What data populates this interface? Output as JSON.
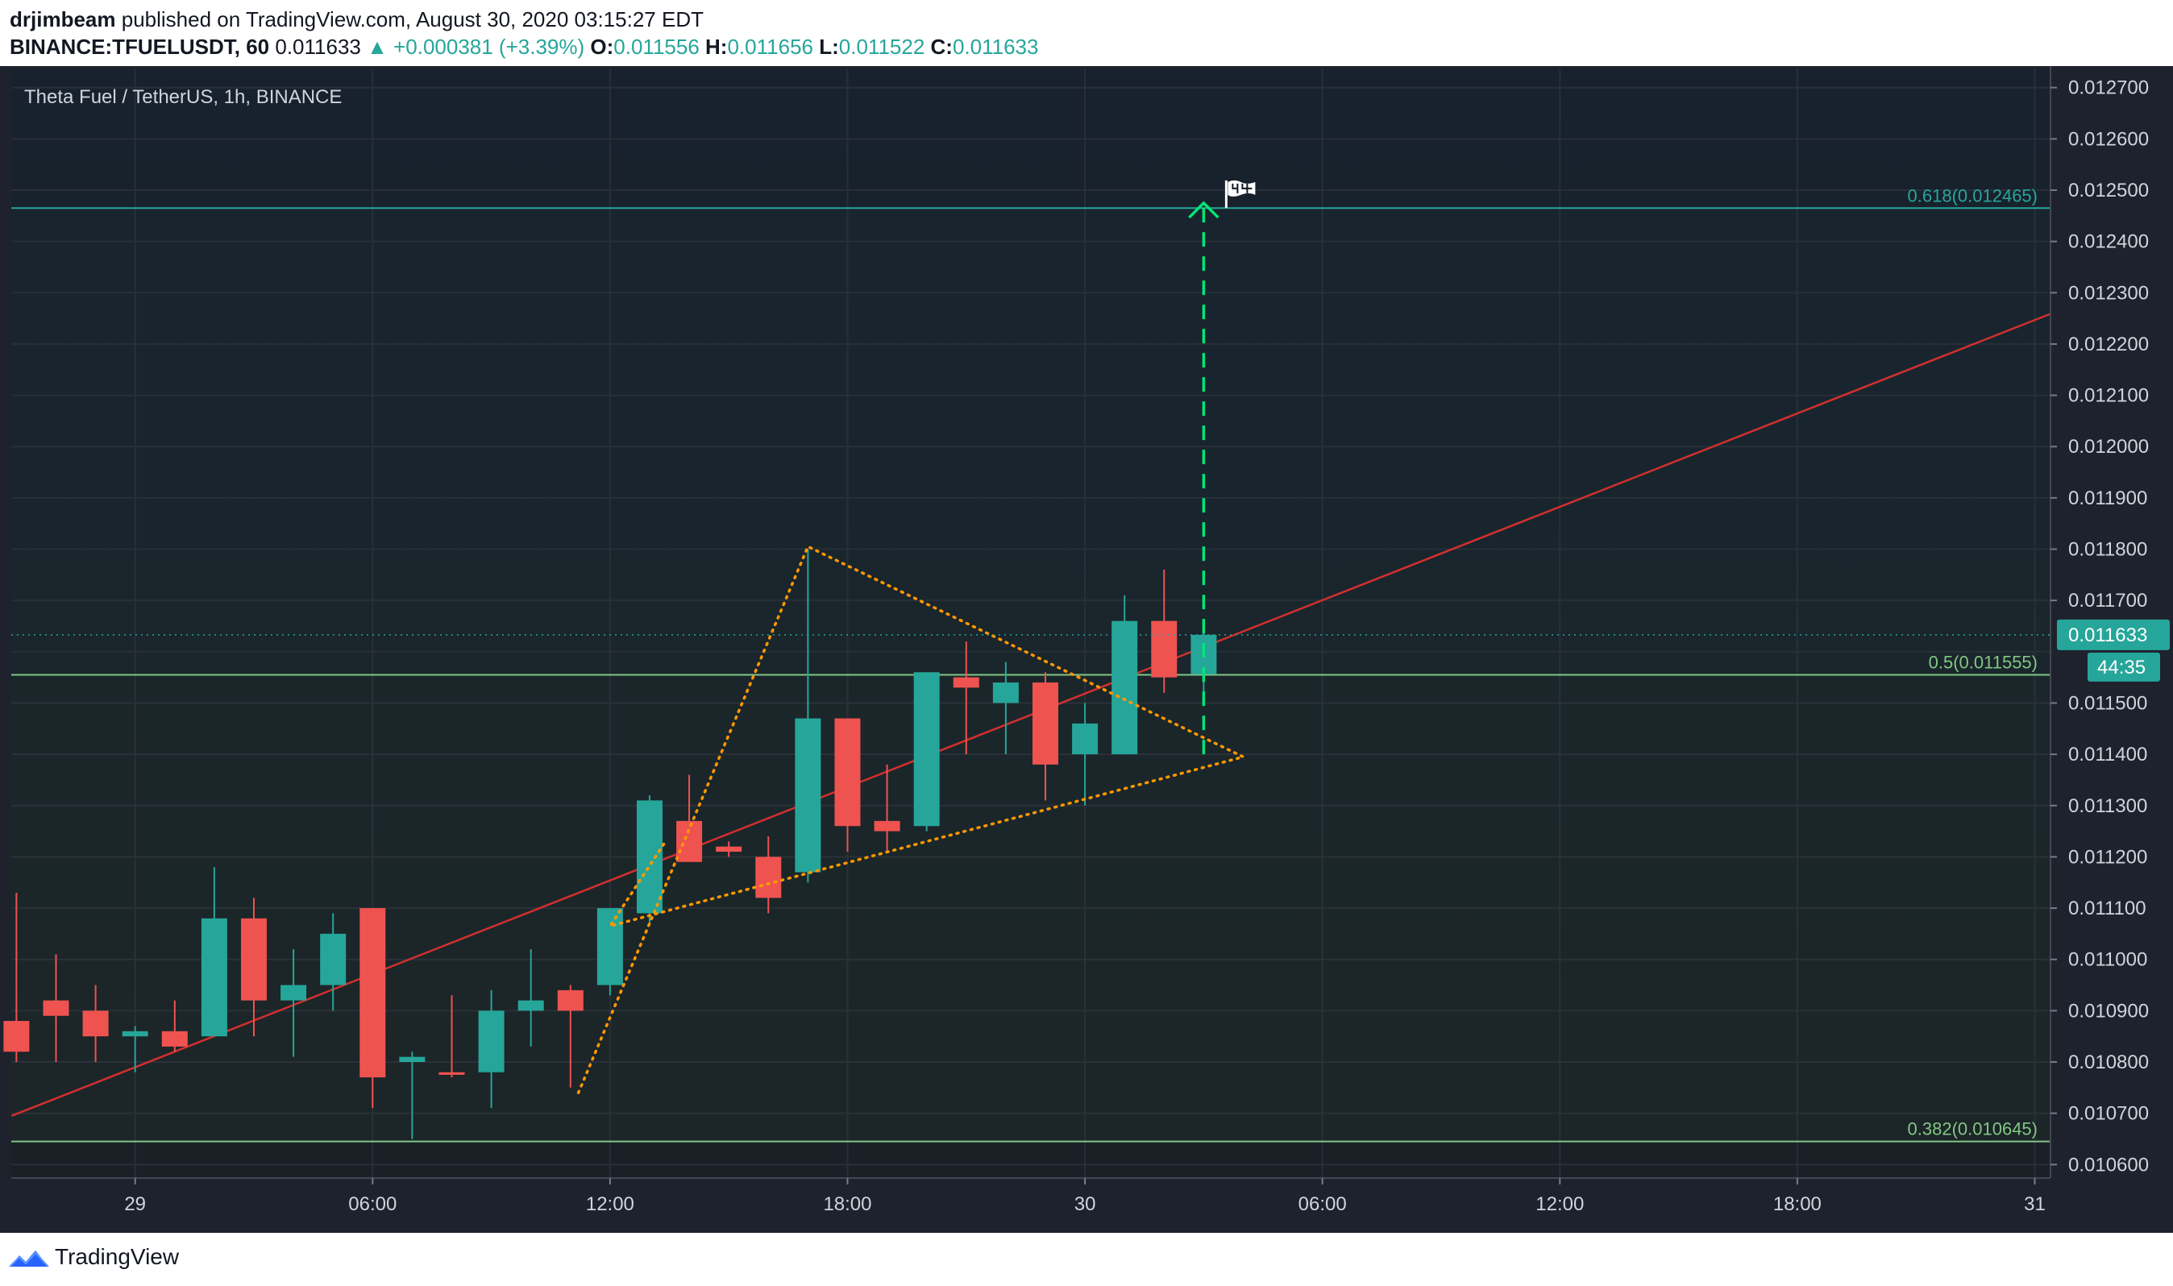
{
  "header": {
    "author": "drjimbeam",
    "published_text": "published on TradingView.com, August 30, 2020 03:15:27 EDT",
    "symbol": "BINANCE:TFUELUSDT, 60",
    "last": "0.011633",
    "change": "▲ +0.000381 (+3.39%)",
    "o_label": "O:",
    "o_value": "0.011556",
    "h_label": "H:",
    "h_value": "0.011656",
    "l_label": "L:",
    "l_value": "0.011522",
    "c_label": "C:",
    "c_value": "0.011633"
  },
  "footer": {
    "brand": "TradingView",
    "logo_icon": "tradingview-logo-icon"
  },
  "chart_data": {
    "type": "candlestick",
    "title": "Theta Fuel / TetherUS, 1h, BINANCE",
    "ylim": [
      0.01058,
      0.01272
    ],
    "y_ticks": [
      "0.012700",
      "0.012600",
      "0.012500",
      "0.012400",
      "0.012300",
      "0.012200",
      "0.012100",
      "0.012000",
      "0.011900",
      "0.011800",
      "0.011700",
      "0.011600",
      "0.011500",
      "0.011400",
      "0.011300",
      "0.011200",
      "0.011100",
      "0.011000",
      "0.010900",
      "0.010800",
      "0.010700",
      "0.010600"
    ],
    "x_ticks": [
      {
        "label": "29",
        "h": 3
      },
      {
        "label": "06:00",
        "h": 9
      },
      {
        "label": "12:00",
        "h": 15
      },
      {
        "label": "18:00",
        "h": 21
      },
      {
        "label": "30",
        "h": 27
      },
      {
        "label": "06:00",
        "h": 33
      },
      {
        "label": "12:00",
        "h": 39
      },
      {
        "label": "18:00",
        "h": 45
      },
      {
        "label": "31",
        "h": 51
      }
    ],
    "x_note": "h = hours from Aug 28 21:00",
    "candles": [
      {
        "h": 0,
        "o": 0.01088,
        "hi": 0.01113,
        "l": 0.0108,
        "c": 0.01082
      },
      {
        "h": 1,
        "o": 0.01092,
        "hi": 0.01101,
        "l": 0.0108,
        "c": 0.01089
      },
      {
        "h": 2,
        "o": 0.0109,
        "hi": 0.01095,
        "l": 0.0108,
        "c": 0.01085
      },
      {
        "h": 3,
        "o": 0.01085,
        "hi": 0.01087,
        "l": 0.01078,
        "c": 0.01086
      },
      {
        "h": 4,
        "o": 0.01086,
        "hi": 0.01092,
        "l": 0.01082,
        "c": 0.01083
      },
      {
        "h": 5,
        "o": 0.01085,
        "hi": 0.01118,
        "l": 0.01085,
        "c": 0.01108
      },
      {
        "h": 6,
        "o": 0.01108,
        "hi": 0.01112,
        "l": 0.01085,
        "c": 0.01092
      },
      {
        "h": 7,
        "o": 0.01092,
        "hi": 0.01102,
        "l": 0.01081,
        "c": 0.01095
      },
      {
        "h": 8,
        "o": 0.01095,
        "hi": 0.01109,
        "l": 0.0109,
        "c": 0.01105
      },
      {
        "h": 9,
        "o": 0.0111,
        "hi": 0.0111,
        "l": 0.01071,
        "c": 0.01077
      },
      {
        "h": 10,
        "o": 0.0108,
        "hi": 0.01082,
        "l": 0.01065,
        "c": 0.01081
      },
      {
        "h": 11,
        "o": 0.01078,
        "hi": 0.01093,
        "l": 0.01077,
        "c": 0.010775
      },
      {
        "h": 12,
        "o": 0.01078,
        "hi": 0.01094,
        "l": 0.01071,
        "c": 0.0109
      },
      {
        "h": 13,
        "o": 0.0109,
        "hi": 0.01102,
        "l": 0.01083,
        "c": 0.01092
      },
      {
        "h": 14,
        "o": 0.01094,
        "hi": 0.01095,
        "l": 0.01075,
        "c": 0.0109
      },
      {
        "h": 15,
        "o": 0.01095,
        "hi": 0.0111,
        "l": 0.01093,
        "c": 0.0111
      },
      {
        "h": 16,
        "o": 0.01109,
        "hi": 0.01132,
        "l": 0.01107,
        "c": 0.01131
      },
      {
        "h": 17,
        "o": 0.01127,
        "hi": 0.01136,
        "l": 0.0112,
        "c": 0.01119
      },
      {
        "h": 18,
        "o": 0.01122,
        "hi": 0.01123,
        "l": 0.0112,
        "c": 0.01121
      },
      {
        "h": 19,
        "o": 0.0112,
        "hi": 0.01124,
        "l": 0.01109,
        "c": 0.01112
      },
      {
        "h": 20,
        "o": 0.01117,
        "hi": 0.0118,
        "l": 0.01115,
        "c": 0.01147
      },
      {
        "h": 21,
        "o": 0.01147,
        "hi": 0.01147,
        "l": 0.01121,
        "c": 0.01126
      },
      {
        "h": 22,
        "o": 0.01127,
        "hi": 0.01138,
        "l": 0.01121,
        "c": 0.01125
      },
      {
        "h": 23,
        "o": 0.01126,
        "hi": 0.01156,
        "l": 0.01125,
        "c": 0.01156
      },
      {
        "h": 24,
        "o": 0.01155,
        "hi": 0.01162,
        "l": 0.0114,
        "c": 0.01153
      },
      {
        "h": 25,
        "o": 0.0115,
        "hi": 0.01158,
        "l": 0.0114,
        "c": 0.01154
      },
      {
        "h": 26,
        "o": 0.01154,
        "hi": 0.01156,
        "l": 0.01131,
        "c": 0.01138
      },
      {
        "h": 27,
        "o": 0.0114,
        "hi": 0.0115,
        "l": 0.0113,
        "c": 0.01146
      },
      {
        "h": 28,
        "o": 0.0114,
        "hi": 0.01171,
        "l": 0.0114,
        "c": 0.01166
      },
      {
        "h": 29,
        "o": 0.01166,
        "hi": 0.01176,
        "l": 0.01152,
        "c": 0.01155
      },
      {
        "h": 30,
        "o": 0.011556,
        "hi": 0.011656,
        "l": 0.011522,
        "c": 0.011633
      }
    ],
    "fib_levels": [
      {
        "label": "0.618(0.012465)",
        "value": 0.012465,
        "color": "#26a69a"
      },
      {
        "label": "0.5(0.011555)",
        "value": 0.011555,
        "color": "#81c784"
      },
      {
        "label": "0.382(0.010645)",
        "value": 0.010645,
        "color": "#81c784"
      }
    ],
    "trendline": {
      "color": "#d32f2f",
      "points": [
        {
          "h": 0,
          "v": 0.010695
        },
        {
          "h": 51.6,
          "v": 0.012265
        }
      ]
    },
    "pennant": {
      "color": "#ff9800",
      "points": [
        {
          "h": 14.2,
          "v": 0.01074
        },
        {
          "h": 20.0,
          "v": 0.011805
        },
        {
          "h": 31.0,
          "v": 0.011395
        },
        {
          "h": 15.0,
          "v": 0.011065
        },
        {
          "h": 16.4,
          "v": 0.01123
        }
      ]
    },
    "target_arrow": {
      "h": 30,
      "from": 0.0114,
      "to": 0.012475,
      "color": "#00e676"
    },
    "flag_icon": "flag-icon",
    "current_price": {
      "value": 0.011633,
      "label": "0.011633",
      "countdown": "44:35",
      "color": "#26a69a"
    },
    "colors": {
      "up": "#26a69a",
      "down": "#ef5350",
      "background": "#131722",
      "grid": "#2a2e39"
    }
  }
}
